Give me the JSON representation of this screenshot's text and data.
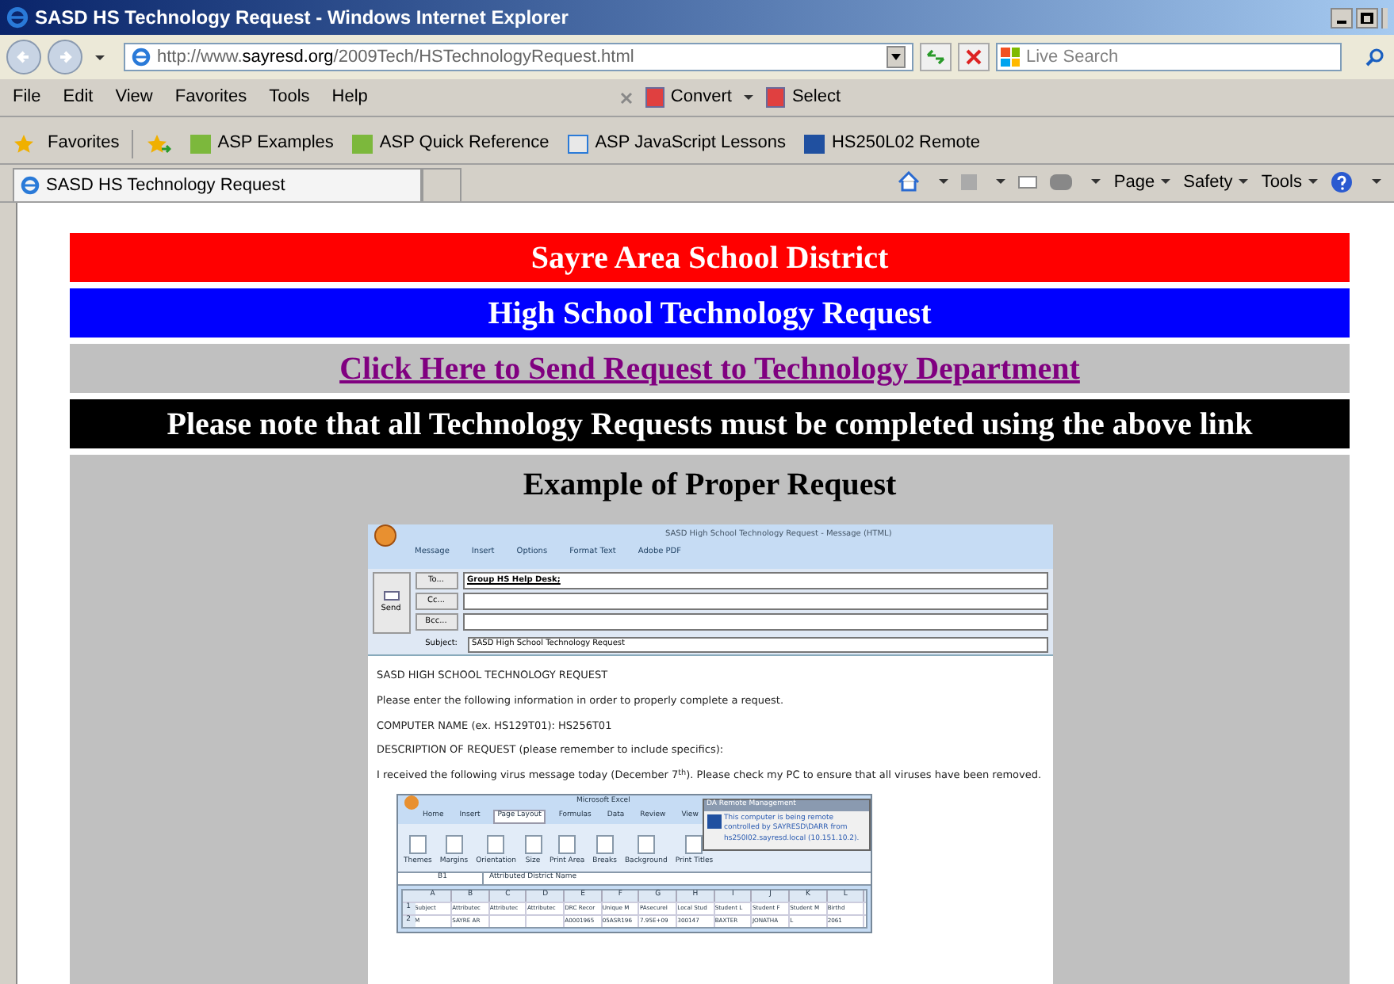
{
  "window": {
    "title": "SASD HS Technology Request - Windows Internet Explorer"
  },
  "address_bar": {
    "url": "http://www.**sayresd.org**/2009Tech/HSTechnologyRequest.html"
  },
  "search": {
    "placeholder": "Live Search"
  },
  "menu": [
    "File",
    "Edit",
    "View",
    "Favorites",
    "Tools",
    "Help"
  ],
  "toolbar": [
    "Convert",
    "Select"
  ],
  "favorites_bar": {
    "label": "Favorites",
    "links": [
      "ASP Examples",
      "ASP Quick Reference",
      "ASP JavaScript Lessons",
      "HS250L02 Remote"
    ]
  },
  "tabs": [
    {
      "label": "SASD HS Technology Request",
      "selected": true
    }
  ],
  "command_bar": [
    "Page",
    "Safety",
    "Tools"
  ],
  "banners": [
    {
      "kind": "title",
      "text": "Sayre Area School District"
    },
    {
      "kind": "subtitle",
      "text": "High School Technology Request"
    },
    {
      "kind": "link",
      "text": "Click Here to Send Request to Technology Department"
    },
    {
      "kind": "notice",
      "text": "Please note that all Technology Requests must be completed using the above link"
    }
  ],
  "example": {
    "heading": "Example of Proper Request",
    "email": {
      "title": "SASD High School Technology Request - Message (HTML)",
      "ribbon_tabs": [
        "Message",
        "Insert",
        "Options",
        "Format Text",
        "Adobe PDF"
      ],
      "send": "Send",
      "recipients": [
        {
          "label": "To...",
          "value": "Group HS Help Desk;"
        },
        {
          "label": "Cc..."
        },
        {
          "label": "Bcc..."
        }
      ],
      "subject": {
        "label": "Subject:",
        "value": "SASD High School Technology Request"
      },
      "body": [
        "SASD HIGH SCHOOL TECHNOLOGY REQUEST",
        "Please enter the following information in order to properly complete a request.",
        "COMPUTER NAME (ex. HS129T01):   HS256T01",
        "DESCRIPTION OF REQUEST (please remember to include specifics):",
        "I received the following virus message today (December 7$^{th}$).  Please check my PC to ensure that all viruses have been removed."
      ],
      "excel": {
        "title": "Microsoft Excel",
        "tabs": [
          {
            "label": "Home",
            "selected": false
          },
          {
            "label": "Insert",
            "selected": false
          },
          {
            "label": "Page Layout",
            "selected": true
          },
          {
            "label": "Formulas",
            "selected": false
          },
          {
            "label": "Data",
            "selected": false
          },
          {
            "label": "Review",
            "selected": false
          },
          {
            "label": "View",
            "selected": false
          }
        ],
        "ribbon_buttons": [
          "Themes",
          "Margins",
          "Orientation",
          "Size",
          "Print Area",
          "Breaks",
          "Background",
          "Print Titles"
        ],
        "name_box": "B1",
        "formula": "Attributed District Name",
        "popup": {
          "title": "DA Remote Management",
          "text": "This computer is being remote controlled by SAYRESD\\DARR from hs250l02.sayresd.local (10.151.10.2)."
        },
        "columns": [
          "A",
          "B",
          "C",
          "D",
          "E",
          "F",
          "G",
          "H",
          "I",
          "J",
          "K",
          "L"
        ],
        "rows": [
          {
            "number": "1",
            "cells": [
              "Subject",
              "Attributec",
              "Attributec",
              "Attributec",
              "DRC Recor",
              "Unique M",
              "PAsecureI",
              "Local Stud",
              "Student L",
              "Student F",
              "Student M",
              "Birthd"
            ]
          },
          {
            "number": "2",
            "cells": [
              "M",
              "SAYRE AR",
              "",
              "",
              "A0001965",
              "05ASR196",
              "7.95E+09",
              "300147",
              "BAXTER",
              "JONATHA",
              "L",
              "2061"
            ]
          }
        ]
      }
    }
  }
}
